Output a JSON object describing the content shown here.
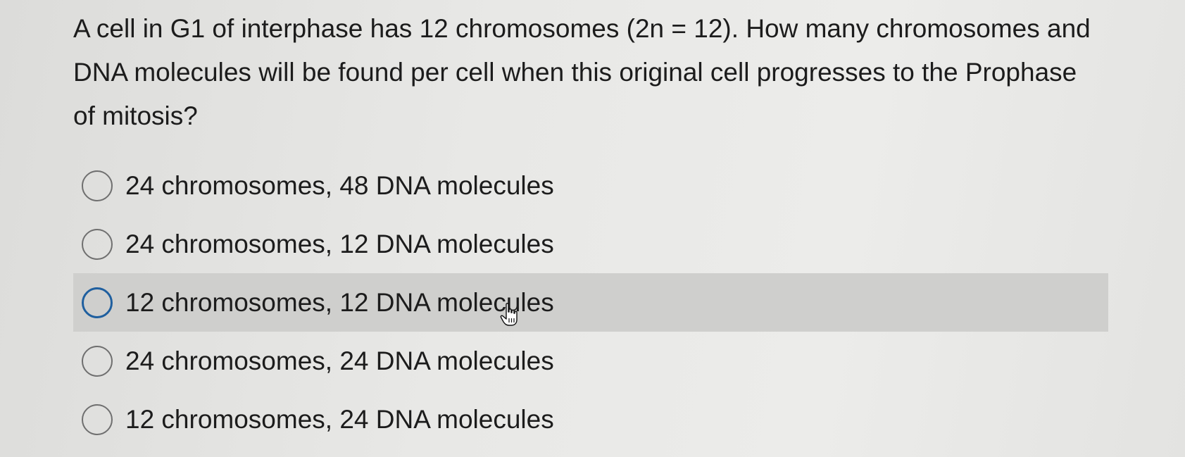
{
  "question": {
    "text": "A cell in G1 of interphase has 12 chromosomes (2n = 12). How many chromosomes and DNA molecules will be found per cell when this original cell progresses to the Prophase of mitosis?"
  },
  "options": [
    {
      "label": "24 chromosomes, 48 DNA molecules",
      "selected": false
    },
    {
      "label": "24 chromosomes, 12 DNA molecules",
      "selected": false
    },
    {
      "label": "12 chromosomes, 12 DNA molecules",
      "selected": false,
      "hovered": true
    },
    {
      "label": "24 chromosomes, 24 DNA molecules",
      "selected": false
    },
    {
      "label": "12 chromosomes, 24 DNA molecules",
      "selected": false
    }
  ],
  "colors": {
    "hover_background": "#cfcfcd",
    "radio_border": "#6f6f6f",
    "radio_hover_border": "#1f5f9f"
  },
  "cursor": {
    "icon": "hand-pointer-icon"
  }
}
